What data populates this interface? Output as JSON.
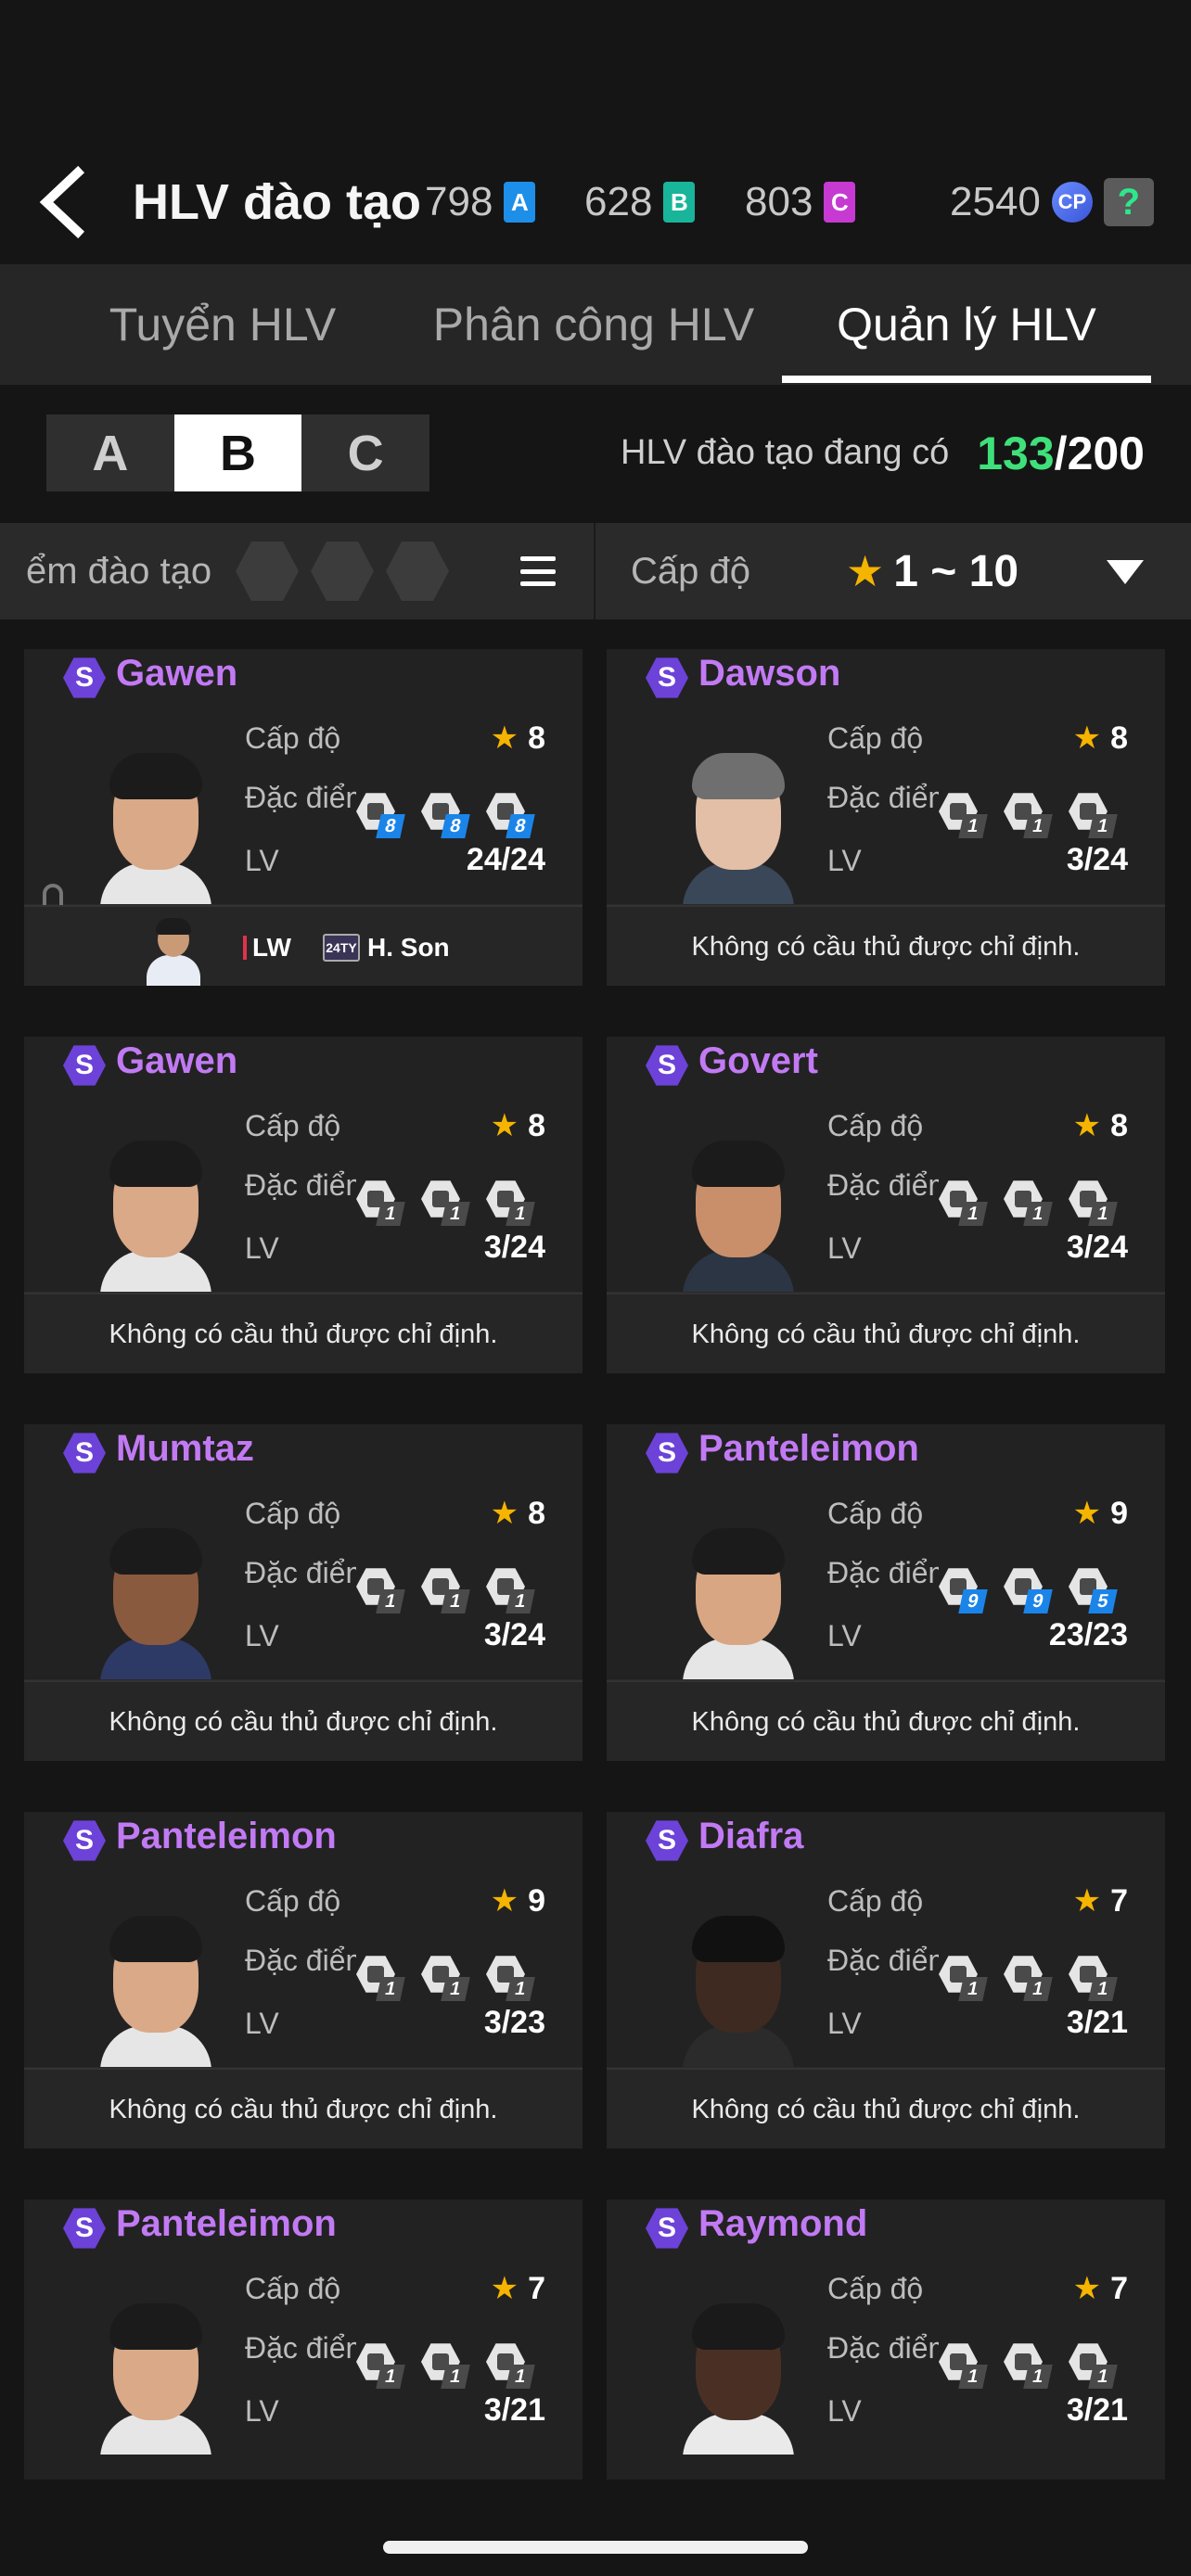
{
  "header": {
    "title": "HLV đào tạo",
    "currencies": [
      {
        "value": "798",
        "badge": "A",
        "color": "#1d8fe9"
      },
      {
        "value": "628",
        "badge": "B",
        "color": "#18b59a"
      },
      {
        "value": "803",
        "badge": "C",
        "color": "#c63ad2"
      }
    ],
    "cp": {
      "value": "2540",
      "badge": "CP"
    },
    "help": "?"
  },
  "tabs": [
    {
      "label": "Tuyển HLV",
      "active": false
    },
    {
      "label": "Phân công  HLV",
      "active": false
    },
    {
      "label": "Quản lý HLV",
      "active": true
    }
  ],
  "grade_tabs": [
    {
      "label": "A",
      "active": false
    },
    {
      "label": "B",
      "active": true
    },
    {
      "label": "C",
      "active": false
    }
  ],
  "owned": {
    "label": "HLV đào tạo đang có",
    "current": "133",
    "max": "/200"
  },
  "filter": {
    "trait_label": "ểm đào tạo",
    "level_label": "Cấp độ",
    "level_range": "1 ~ 10"
  },
  "labels": {
    "level": "Cấp độ",
    "traits": "Đặc điểm",
    "lv": "LV"
  },
  "empty_text": "Không có cầu thủ được chỉ định.",
  "coaches": [
    {
      "name": "Gawen",
      "grade": "S",
      "level": "8",
      "lv": "24/24",
      "traits": [
        {
          "n": "8",
          "hi": true
        },
        {
          "n": "8",
          "hi": true
        },
        {
          "n": "8",
          "hi": true
        }
      ],
      "assigned": {
        "pos": "LW",
        "season": "24TY",
        "player": "H. Son"
      }
    },
    {
      "name": "Dawson",
      "grade": "S",
      "level": "8",
      "lv": "3/24",
      "traits": [
        {
          "n": "1",
          "hi": false
        },
        {
          "n": "1",
          "hi": false
        },
        {
          "n": "1",
          "hi": false
        }
      ]
    },
    {
      "name": "Gawen",
      "grade": "S",
      "level": "8",
      "lv": "3/24",
      "traits": [
        {
          "n": "1",
          "hi": false
        },
        {
          "n": "1",
          "hi": false
        },
        {
          "n": "1",
          "hi": false
        }
      ]
    },
    {
      "name": "Govert",
      "grade": "S",
      "level": "8",
      "lv": "3/24",
      "traits": [
        {
          "n": "1",
          "hi": false
        },
        {
          "n": "1",
          "hi": false
        },
        {
          "n": "1",
          "hi": false
        }
      ]
    },
    {
      "name": "Mumtaz",
      "grade": "S",
      "level": "8",
      "lv": "3/24",
      "traits": [
        {
          "n": "1",
          "hi": false
        },
        {
          "n": "1",
          "hi": false
        },
        {
          "n": "1",
          "hi": false
        }
      ]
    },
    {
      "name": "Panteleimon",
      "grade": "S",
      "level": "9",
      "lv": "23/23",
      "traits": [
        {
          "n": "9",
          "hi": true
        },
        {
          "n": "9",
          "hi": true
        },
        {
          "n": "5",
          "hi": true
        }
      ]
    },
    {
      "name": "Panteleimon",
      "grade": "S",
      "level": "9",
      "lv": "3/23",
      "traits": [
        {
          "n": "1",
          "hi": false
        },
        {
          "n": "1",
          "hi": false
        },
        {
          "n": "1",
          "hi": false
        }
      ]
    },
    {
      "name": "Diafra",
      "grade": "S",
      "level": "7",
      "lv": "3/21",
      "traits": [
        {
          "n": "1",
          "hi": false
        },
        {
          "n": "1",
          "hi": false
        },
        {
          "n": "1",
          "hi": false
        }
      ]
    },
    {
      "name": "Panteleimon",
      "grade": "S",
      "level": "7",
      "lv": "3/21",
      "traits": [
        {
          "n": "1",
          "hi": false
        },
        {
          "n": "1",
          "hi": false
        },
        {
          "n": "1",
          "hi": false
        }
      ]
    },
    {
      "name": "Raymond",
      "grade": "S",
      "level": "7",
      "lv": "3/21",
      "traits": [
        {
          "n": "1",
          "hi": false
        },
        {
          "n": "1",
          "hi": false
        },
        {
          "n": "1",
          "hi": false
        }
      ]
    }
  ]
}
